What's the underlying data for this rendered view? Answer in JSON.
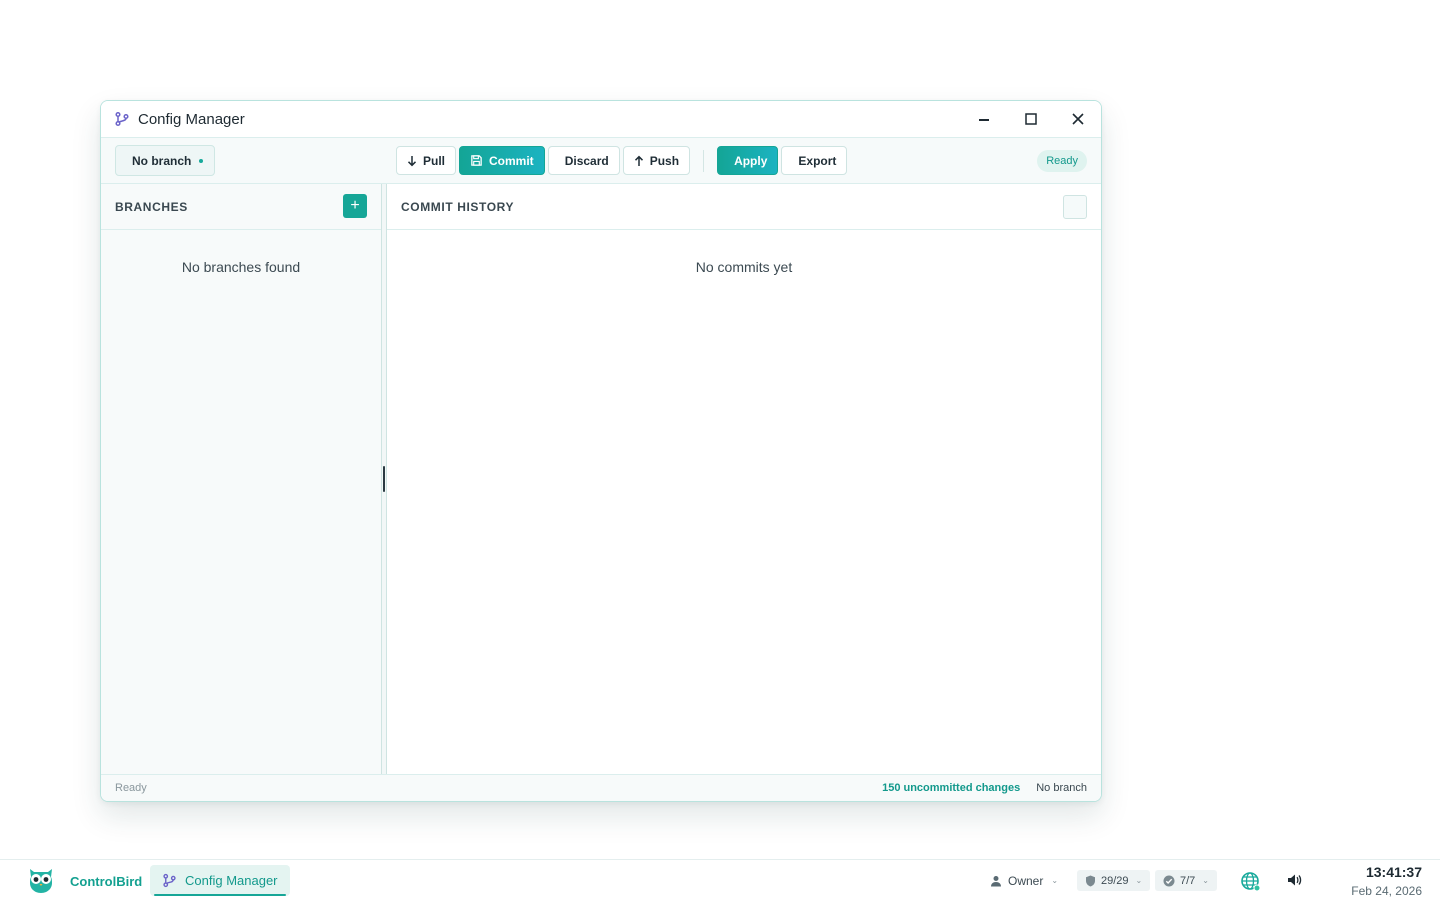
{
  "window": {
    "title": "Config Manager",
    "title_icon": "git-branch-icon"
  },
  "toolbar": {
    "branch_label": "No branch",
    "branch_glyph": "",
    "pull_label": "Pull",
    "commit_label": "Commit",
    "discard_label": "Discard",
    "discard_glyph": "",
    "push_label": "Push",
    "apply_label": "Apply",
    "apply_glyph": "",
    "export_label": "Export",
    "export_glyph": "",
    "status": "Ready"
  },
  "branches_panel": {
    "title": "BRANCHES",
    "add_label": "+",
    "empty_text": "No branches found"
  },
  "history_panel": {
    "title": "COMMIT HISTORY",
    "action_glyph": "",
    "empty_text": "No commits yet"
  },
  "statusbar": {
    "left": "Ready",
    "changes": "150 uncommitted changes",
    "branch_glyph": "",
    "branch": "No branch"
  },
  "taskbar": {
    "brand": "ControlBird",
    "app_label": "Config Manager",
    "owner_label": "Owner",
    "shield_count": "29/29",
    "check_count": "7/7",
    "time": "13:41:37",
    "date": "Feb 24, 2026"
  },
  "colors": {
    "accent": "#16a697",
    "accent_gradient_end": "#1bb3c1",
    "window_border": "#b9e3de",
    "status_pill_bg": "#dff3ef",
    "icon_purple": "#6b63c9"
  }
}
